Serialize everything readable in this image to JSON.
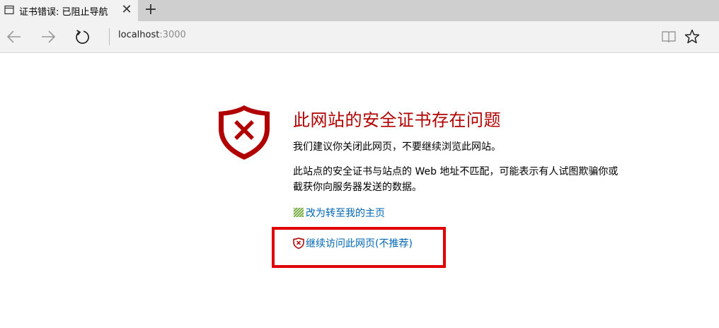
{
  "tab": {
    "title": "证书错误: 已阻止导航",
    "close_glyph": "✕",
    "new_tab_glyph": "+"
  },
  "toolbar": {
    "address_host": "localhost",
    "address_port": ":3000"
  },
  "error": {
    "title": "此网站的安全证书存在问题",
    "recommendation": "我们建议你关闭此网页，不要继续浏览此网站。",
    "detail": "此站点的安全证书与站点的 Web 地址不匹配，可能表示有人试图欺骗你或截获你向服务器发送的数据。",
    "home_link": "改为转至我的主页",
    "continue_link": "继续访问此网页(不推荐)"
  },
  "colors": {
    "error_red": "#b00000",
    "link_blue": "#0066b4",
    "highlight_red": "#e00000"
  },
  "icons": {
    "tab": "page-icon",
    "back": "back-arrow-icon",
    "forward": "forward-arrow-icon",
    "refresh": "refresh-icon",
    "reading_view": "book-icon",
    "favorite": "star-icon",
    "shield": "shield-x-icon",
    "home": "home-icon",
    "continue": "small-shield-x-icon"
  }
}
